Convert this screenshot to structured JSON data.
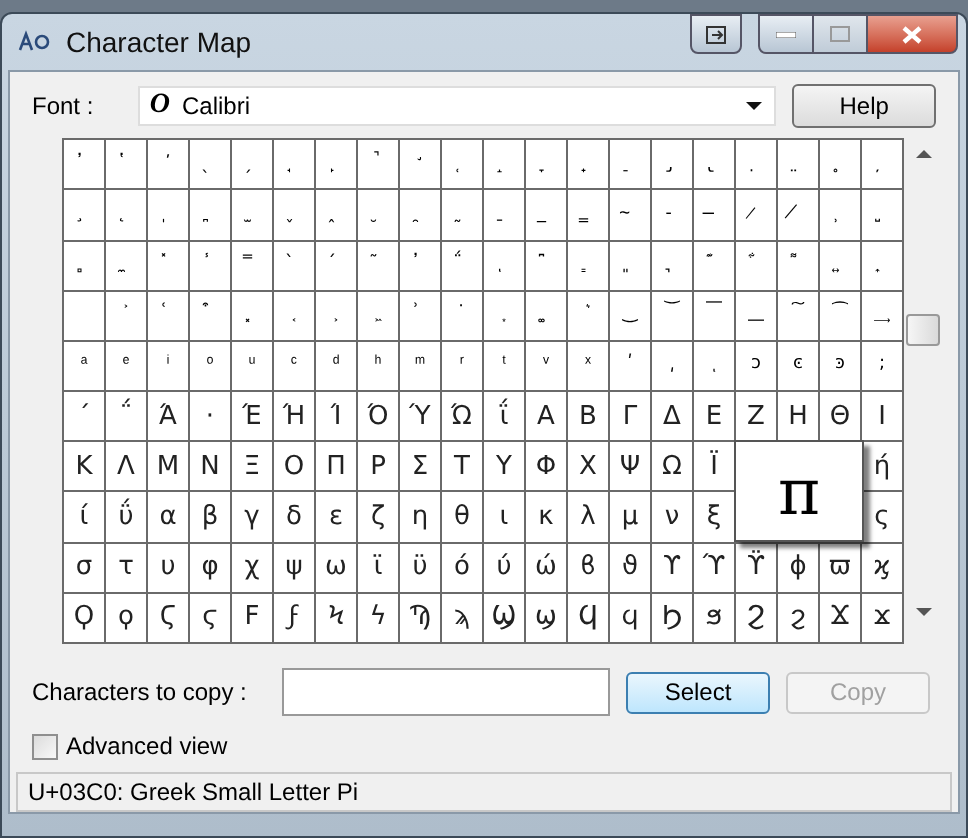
{
  "window": {
    "title": "Character Map"
  },
  "font": {
    "label": "Font :",
    "value": "Calibri",
    "font_glyph": "O"
  },
  "help_button": "Help",
  "grid_rows": [
    [
      "̓",
      "̔",
      "̕",
      "̖",
      "̗",
      "̘",
      "̙",
      "̚",
      "̛",
      "̜",
      "̝",
      "̞",
      "̟",
      "̠",
      "̡",
      "̢",
      "̣",
      "̤",
      "̥",
      "̦"
    ],
    [
      "̧",
      "̨",
      "̩",
      "̪",
      "̫",
      "̬",
      "̭",
      "̮",
      "̯",
      "̰",
      "̱",
      "̲",
      "̳",
      "̴",
      "̵",
      "̶",
      "̷",
      "̸",
      "̹",
      "̺"
    ],
    [
      "̻",
      "̼",
      "̽",
      "̾",
      "̿",
      "̀",
      "́",
      "͂",
      "̓",
      "̈́",
      "ͅ",
      "͆",
      "͇",
      "͈",
      "͉",
      "͊",
      "͋",
      "͌",
      "͍",
      "͎"
    ],
    [
      null,
      "͐",
      "͑",
      "͒",
      "͓",
      "͔",
      "͕",
      "͖",
      "͗",
      "͘",
      "͙",
      "͚",
      "͛",
      "͜",
      "͝",
      "͞",
      "͟",
      "͠",
      "͡",
      "͢"
    ],
    [
      "ͣ",
      "ͤ",
      "ͥ",
      "ͦ",
      "ͧ",
      "ͨ",
      "ͩ",
      "ͪ",
      "ͫ",
      "ͬ",
      "ͭ",
      "ͮ",
      "ͯ",
      "ʹ",
      "͵",
      "ͺ",
      "ͻ",
      "ͼ",
      "ͽ",
      ";"
    ],
    [
      "΄",
      "΅",
      "Ά",
      "·",
      "Έ",
      "Ή",
      "Ί",
      "Ό",
      "Ύ",
      "Ώ",
      "ΐ",
      "Α",
      "Β",
      "Γ",
      "Δ",
      "Ε",
      "Ζ",
      "Η",
      "Θ",
      "Ι"
    ],
    [
      "Κ",
      "Λ",
      "Μ",
      "Ν",
      "Ξ",
      "Ο",
      "Π",
      "Ρ",
      "Σ",
      "Τ",
      "Υ",
      "Φ",
      "Χ",
      "Ψ",
      "Ω",
      "Ϊ",
      null,
      null,
      null,
      "ή"
    ],
    [
      "ί",
      "ΰ",
      "α",
      "β",
      "γ",
      "δ",
      "ε",
      "ζ",
      "η",
      "θ",
      "ι",
      "κ",
      "λ",
      "μ",
      "ν",
      "ξ",
      null,
      null,
      null,
      "ς"
    ],
    [
      "σ",
      "τ",
      "υ",
      "φ",
      "χ",
      "ψ",
      "ω",
      "ϊ",
      "ϋ",
      "ό",
      "ύ",
      "ώ",
      "ϐ",
      "ϑ",
      "ϒ",
      "ϓ",
      "ϔ",
      "ϕ",
      "ϖ",
      "ϗ"
    ],
    [
      "Ϙ",
      "ϙ",
      "Ϛ",
      "ϛ",
      "Ϝ",
      "ϝ",
      "Ϟ",
      "ϟ",
      "Ϡ",
      "ϡ",
      "Ϣ",
      "ϣ",
      "Ϥ",
      "ϥ",
      "Ϧ",
      "ϧ",
      "Ϩ",
      "ϩ",
      "Ϫ",
      "ϫ"
    ]
  ],
  "enlarged_char": "π",
  "copy_field": {
    "label": "Characters to copy :"
  },
  "select_button": "Select",
  "copy_button": {
    "label": "Copy",
    "disabled": true
  },
  "advanced_view": {
    "label": "Advanced view",
    "checked": false
  },
  "status_bar": "U+03C0: Greek Small Letter Pi"
}
